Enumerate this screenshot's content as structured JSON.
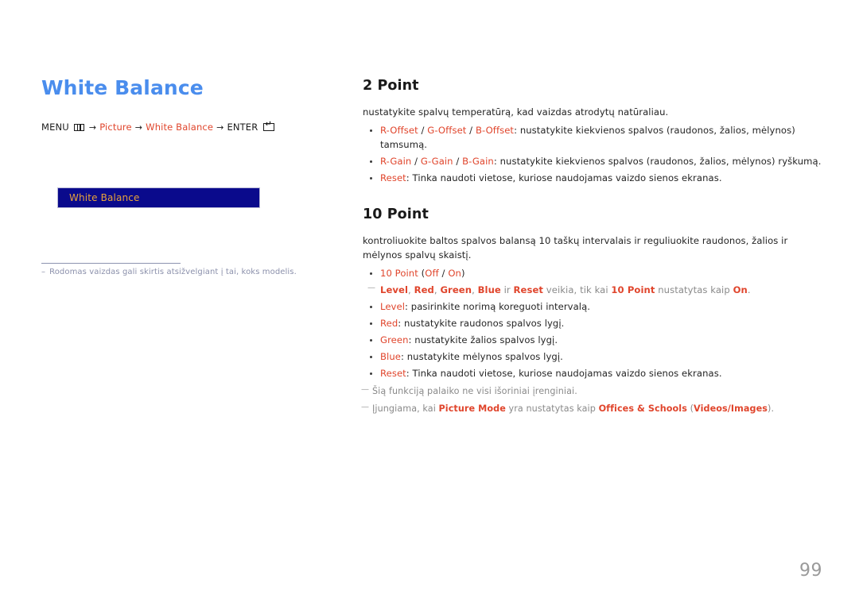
{
  "document": {
    "page_number": "99",
    "accent_color": "#e0452c",
    "title_color": "#4a8ded",
    "menu_box_color": "#0a0a8c",
    "menu_box_text_color": "#e8a33a"
  },
  "left": {
    "title": "White Balance",
    "menu_path": {
      "menu_label": "MENU",
      "menu_icon": "menu-icon",
      "arrow": "→",
      "step1": "Picture",
      "step2": "White Balance",
      "enter_label": "ENTER",
      "enter_icon": "enter-icon"
    },
    "menu_screenshot": {
      "selected_item": "White Balance"
    },
    "note": {
      "dash": "–",
      "text": "Rodomas vaizdas gali skirtis atsižvelgiant į tai, koks modelis."
    }
  },
  "right": {
    "sections": [
      {
        "heading": "2 Point",
        "intro": "nustatykite spalvų temperatūrą, kad vaizdas atrodytų natūraliau.",
        "items": [
          {
            "type": "bullet",
            "parts": [
              {
                "text": "R-Offset",
                "style": "accent"
              },
              {
                "text": " / ",
                "style": "dark"
              },
              {
                "text": "G-Offset",
                "style": "accent"
              },
              {
                "text": " / ",
                "style": "dark"
              },
              {
                "text": "B-Offset",
                "style": "accent"
              },
              {
                "text": ": nustatykite kiekvienos spalvos (raudonos, žalios, mėlynos) tamsumą.",
                "style": "dark"
              }
            ]
          },
          {
            "type": "bullet",
            "parts": [
              {
                "text": "R-Gain",
                "style": "accent"
              },
              {
                "text": " / ",
                "style": "dark"
              },
              {
                "text": "G-Gain",
                "style": "accent"
              },
              {
                "text": " / ",
                "style": "dark"
              },
              {
                "text": "B-Gain",
                "style": "accent"
              },
              {
                "text": ": nustatykite kiekvienos spalvos (raudonos, žalios, mėlynos) ryškumą.",
                "style": "dark"
              }
            ]
          },
          {
            "type": "bullet",
            "parts": [
              {
                "text": "Reset",
                "style": "accent"
              },
              {
                "text": ": Tinka naudoti vietose, kuriose naudojamas vaizdo sienos ekranas.",
                "style": "dark"
              }
            ]
          }
        ]
      },
      {
        "heading": "10 Point",
        "intro": "kontroliuokite baltos spalvos balansą 10 taškų intervalais ir reguliuokite raudonos, žalios ir mėlynos spalvų skaistį.",
        "items": [
          {
            "type": "bullet",
            "parts": [
              {
                "text": "10 Point",
                "style": "accent"
              },
              {
                "text": " (",
                "style": "dark"
              },
              {
                "text": "Off",
                "style": "accent"
              },
              {
                "text": " / ",
                "style": "dark"
              },
              {
                "text": "On",
                "style": "accent"
              },
              {
                "text": ")",
                "style": "dark"
              }
            ]
          },
          {
            "type": "subnote",
            "parts": [
              {
                "text": "Level",
                "style": "accent-b"
              },
              {
                "text": ", ",
                "style": "gray"
              },
              {
                "text": "Red",
                "style": "accent-b"
              },
              {
                "text": ", ",
                "style": "gray"
              },
              {
                "text": "Green",
                "style": "accent-b"
              },
              {
                "text": ", ",
                "style": "gray"
              },
              {
                "text": "Blue",
                "style": "accent-b"
              },
              {
                "text": " ir ",
                "style": "gray"
              },
              {
                "text": "Reset",
                "style": "accent-b"
              },
              {
                "text": " veikia, tik kai ",
                "style": "gray"
              },
              {
                "text": "10 Point",
                "style": "accent-b"
              },
              {
                "text": " nustatytas kaip ",
                "style": "gray"
              },
              {
                "text": "On",
                "style": "accent-b"
              },
              {
                "text": ".",
                "style": "gray"
              }
            ]
          },
          {
            "type": "bullet",
            "parts": [
              {
                "text": "Level",
                "style": "accent"
              },
              {
                "text": ": pasirinkite norimą koreguoti intervalą.",
                "style": "dark"
              }
            ]
          },
          {
            "type": "bullet",
            "parts": [
              {
                "text": "Red",
                "style": "accent"
              },
              {
                "text": ": nustatykite raudonos spalvos lygį.",
                "style": "dark"
              }
            ]
          },
          {
            "type": "bullet",
            "parts": [
              {
                "text": "Green",
                "style": "accent"
              },
              {
                "text": ": nustatykite žalios spalvos lygį.",
                "style": "dark"
              }
            ]
          },
          {
            "type": "bullet",
            "parts": [
              {
                "text": "Blue",
                "style": "accent"
              },
              {
                "text": ": nustatykite mėlynos spalvos lygį.",
                "style": "dark"
              }
            ]
          },
          {
            "type": "bullet",
            "parts": [
              {
                "text": "Reset",
                "style": "accent"
              },
              {
                "text": ": Tinka naudoti vietose, kuriose naudojamas vaizdo sienos ekranas.",
                "style": "dark"
              }
            ]
          }
        ],
        "tail_notes": [
          {
            "parts": [
              {
                "text": "Šią funkciją palaiko ne visi išoriniai įrenginiai.",
                "style": "gray"
              }
            ]
          },
          {
            "parts": [
              {
                "text": "Įjungiama, kai ",
                "style": "gray"
              },
              {
                "text": "Picture Mode",
                "style": "accent-b"
              },
              {
                "text": " yra nustatytas kaip ",
                "style": "gray"
              },
              {
                "text": "Offices & Schools",
                "style": "accent-b"
              },
              {
                "text": " (",
                "style": "gray"
              },
              {
                "text": "Videos/Images",
                "style": "accent-b"
              },
              {
                "text": ").",
                "style": "gray"
              }
            ]
          }
        ]
      }
    ]
  }
}
